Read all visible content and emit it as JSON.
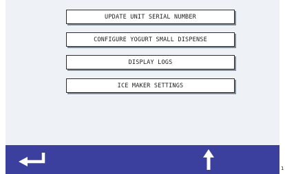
{
  "menu": {
    "items": [
      {
        "label": "UPDATE UNIT SERIAL NUMBER"
      },
      {
        "label": "CONFIGURE YOGURT SMALL DISPENSE"
      },
      {
        "label": "DISPLAY LOGS"
      },
      {
        "label": "ICE MAKER SETTINGS"
      }
    ]
  },
  "bottom_bar": {
    "back_icon": "back-arrow-icon",
    "up_icon": "up-arrow-icon",
    "page_number": "1"
  },
  "colors": {
    "screen_background": "#eef1f6",
    "bottom_bar": "#3b3f9e",
    "button_border": "#2a2a2a",
    "icon_fill": "#ffffff"
  }
}
